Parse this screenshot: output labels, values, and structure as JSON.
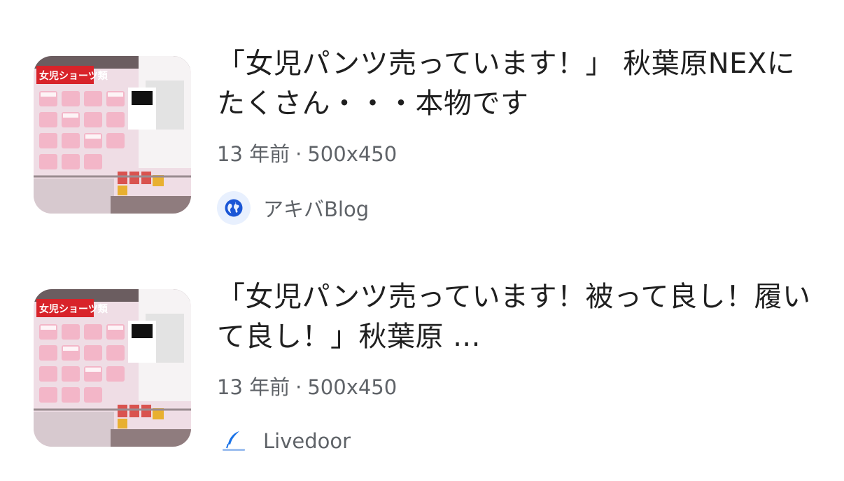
{
  "results": [
    {
      "title": "「女児パンツ売っています！」 秋葉原NEXにたくさん・・・本物です",
      "age": "13 年前",
      "dimensions": "500x450",
      "source": "アキバBlog",
      "favicon_icon": "globe-icon",
      "thumb_sign": "女児ショーツ類"
    },
    {
      "title": "「女児パンツ売っています！被って良し！履いて良し！」秋葉原 ...",
      "age": "13 年前",
      "dimensions": "500x450",
      "source": "Livedoor",
      "favicon_icon": "feather-icon",
      "thumb_sign": "女児ショーツ類"
    }
  ],
  "colors": {
    "title": "#1f1f1f",
    "meta": "#5f6368",
    "globe_bg": "#e8f0fe",
    "globe_fg": "#1a56d6",
    "feather": "#1a73e8"
  }
}
